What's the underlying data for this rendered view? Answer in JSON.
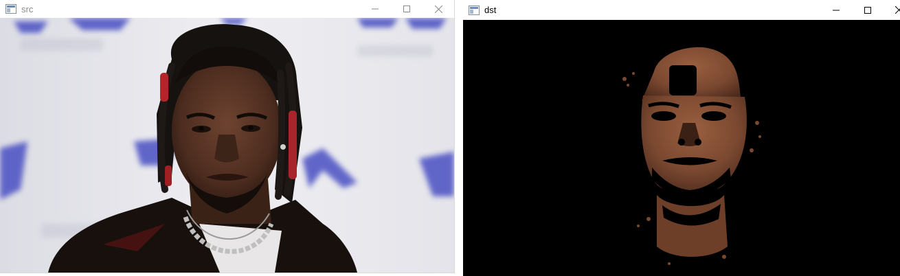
{
  "windows": {
    "src": {
      "title": "src"
    },
    "dst": {
      "title": "dst"
    }
  },
  "icons": {
    "app": "opencv-window-icon",
    "minimize": "minimize-icon",
    "maximize": "maximize-icon",
    "close": "close-icon"
  },
  "colors": {
    "background_stage": "#e6e6ec",
    "brand_blue": "#4a4fc2",
    "skin": "#7a4b33",
    "dst_background": "#000000"
  }
}
